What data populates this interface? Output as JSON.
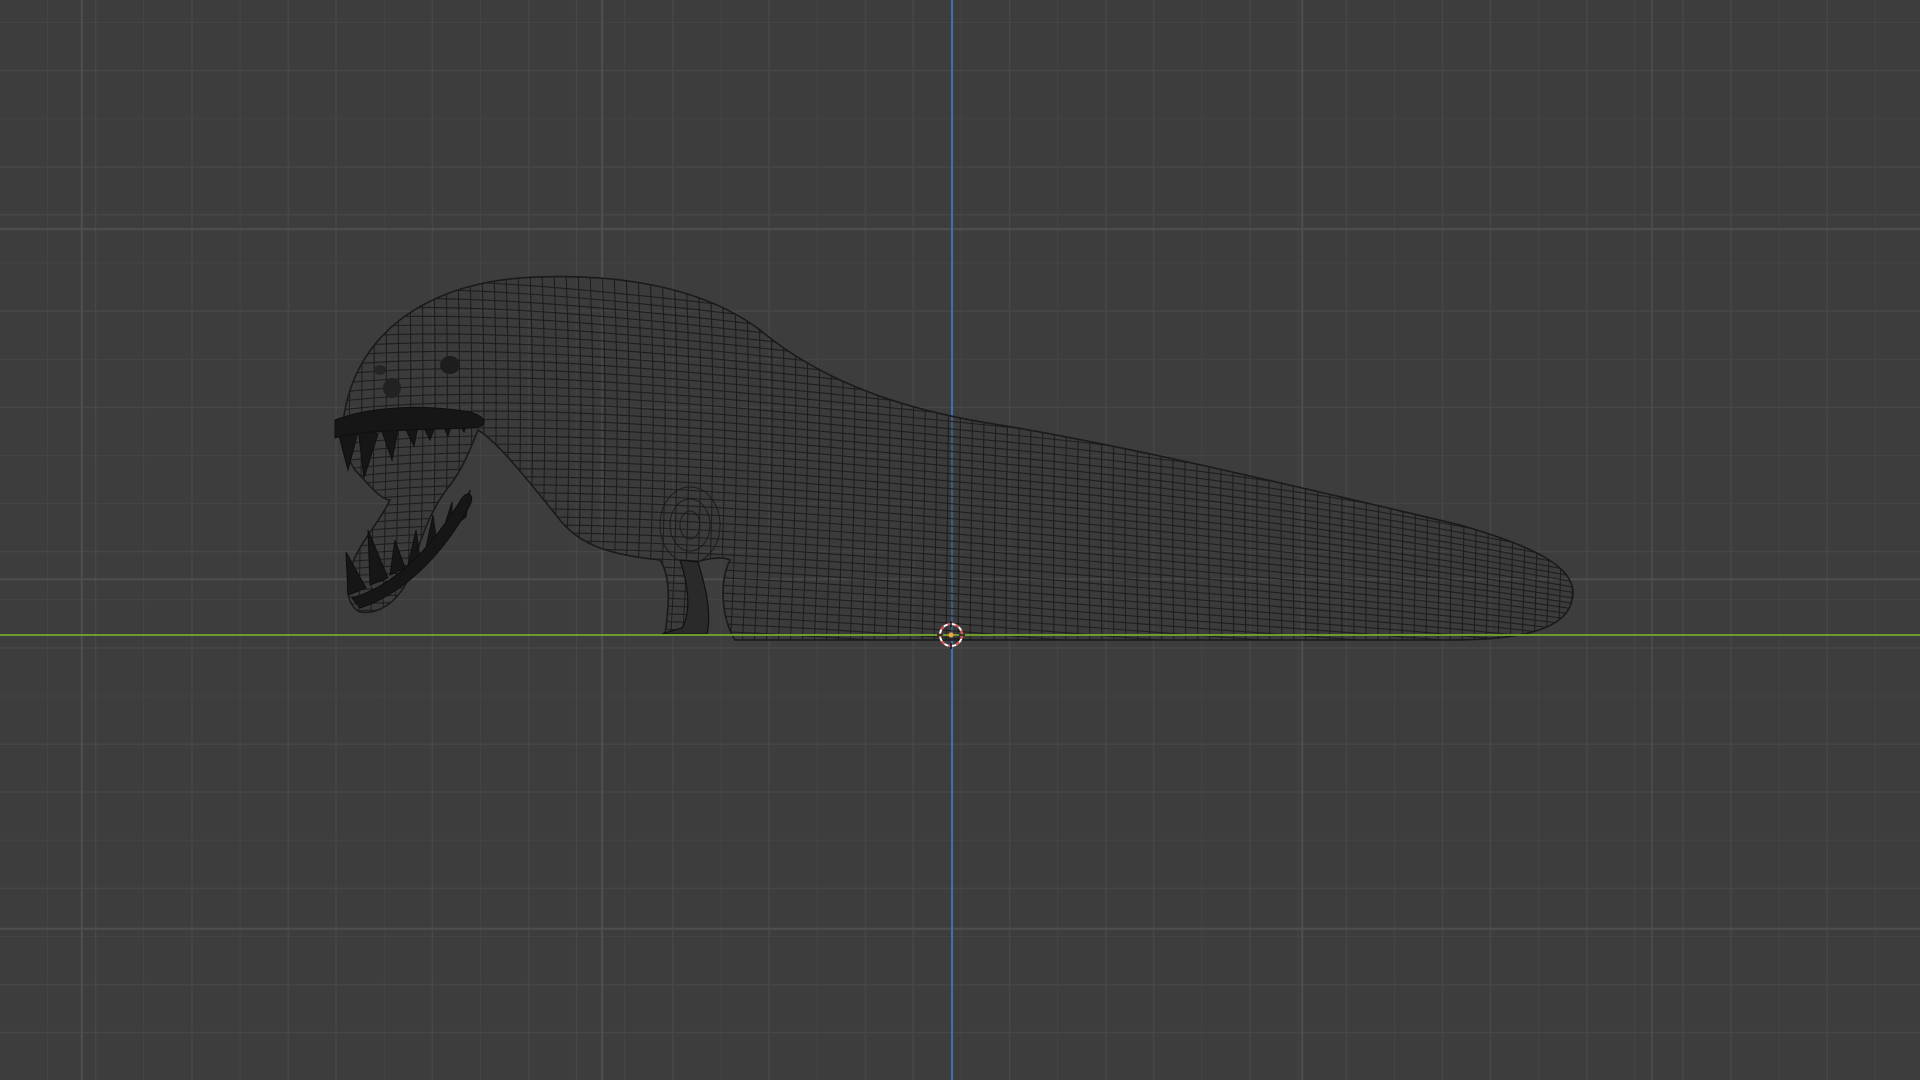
{
  "viewport": {
    "background": "#3d3d3d",
    "grid_minor_color": "#474747",
    "grid_major_color": "#4e4e4e",
    "x_axis_color": "#6f9a2e",
    "z_axis_color": "#3f6eb3"
  },
  "object": {
    "kind": "creature-mesh-wireframe",
    "wire_color": "#1a1a1a"
  },
  "cursor": {
    "icon": "3d-cursor-icon",
    "ring_color_a": "#e35050",
    "ring_color_b": "#ffffff"
  }
}
